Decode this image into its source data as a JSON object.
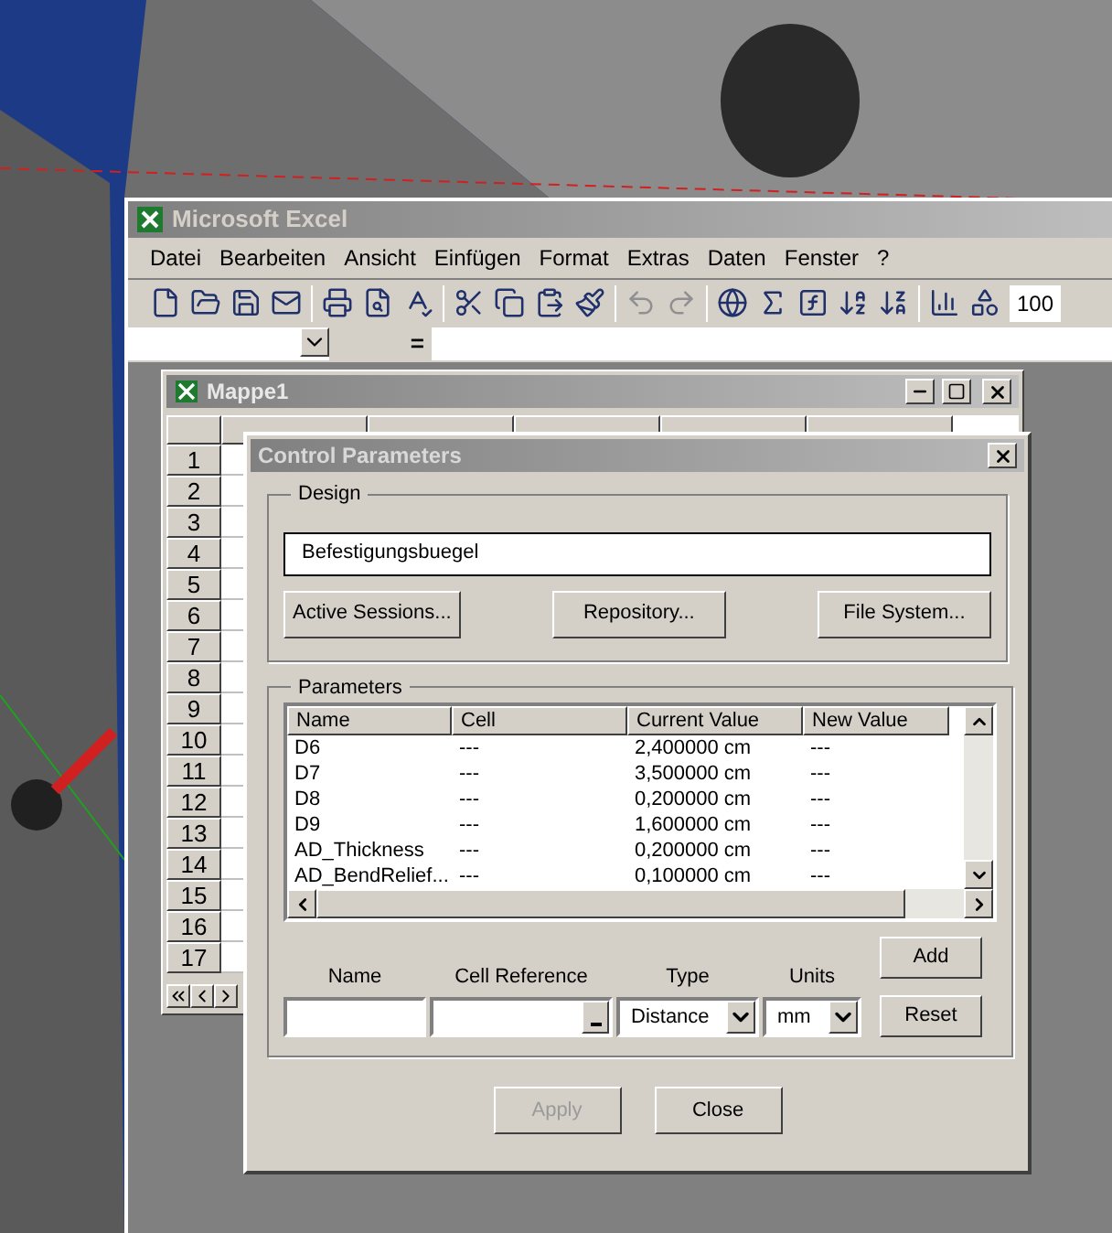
{
  "excel": {
    "title": "Microsoft Excel",
    "menu": [
      "Datei",
      "Bearbeiten",
      "Ansicht",
      "Einfügen",
      "Format",
      "Extras",
      "Daten",
      "Fenster",
      "?"
    ],
    "zoom": "100",
    "formula_equals": "="
  },
  "workbook": {
    "title": "Mappe1",
    "rows": [
      "1",
      "2",
      "3",
      "4",
      "5",
      "6",
      "7",
      "8",
      "9",
      "10",
      "11",
      "12",
      "13",
      "14",
      "15",
      "16",
      "17"
    ]
  },
  "dialog": {
    "title": "Control Parameters",
    "design": {
      "label": "Design",
      "value": "Befestigungsbuegel",
      "buttons": [
        "Active Sessions...",
        "Repository...",
        "File System..."
      ]
    },
    "parameters": {
      "label": "Parameters",
      "columns": [
        "Name",
        "Cell",
        "Current Value",
        "New Value"
      ],
      "rows": [
        [
          "D6",
          "---",
          "2,400000 cm",
          "---"
        ],
        [
          "D7",
          "---",
          "3,500000 cm",
          "---"
        ],
        [
          "D8",
          "---",
          "0,200000 cm",
          "---"
        ],
        [
          "D9",
          "---",
          "1,600000 cm",
          "---"
        ],
        [
          "AD_Thickness",
          "---",
          "0,200000 cm",
          "---"
        ],
        [
          "AD_BendRelief...",
          "---",
          "0,100000 cm",
          "---"
        ]
      ],
      "new": {
        "labels": [
          "Name",
          "Cell Reference",
          "Type",
          "Units"
        ],
        "type": "Distance",
        "units": "mm"
      },
      "side_buttons": [
        "Add",
        "Reset"
      ]
    },
    "footer": [
      {
        "label": "Apply",
        "disabled": true
      },
      {
        "label": "Close",
        "disabled": false
      }
    ]
  }
}
